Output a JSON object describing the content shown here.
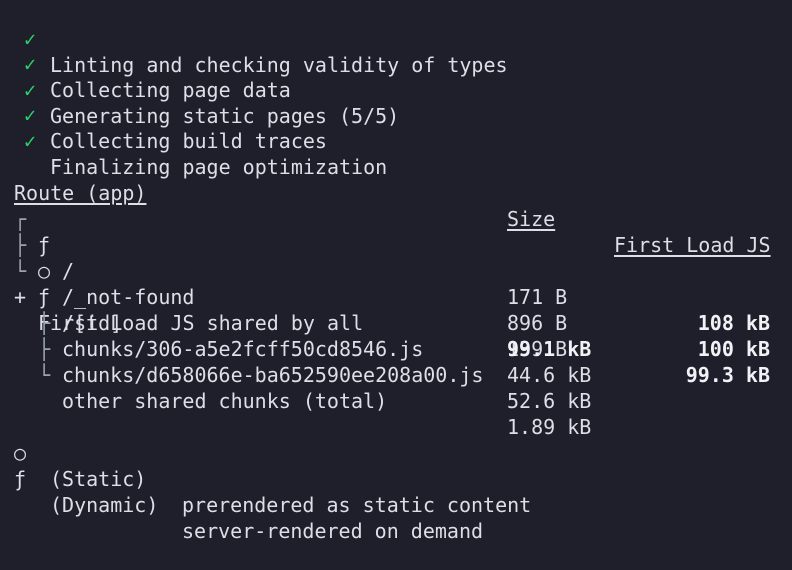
{
  "steps": [
    {
      "icon": "✓",
      "label": "Linting and checking validity of types"
    },
    {
      "icon": "✓",
      "label": "Collecting page data"
    },
    {
      "icon": "✓",
      "label": "Generating static pages (5/5)"
    },
    {
      "icon": "✓",
      "label": "Collecting build traces"
    },
    {
      "icon": "✓",
      "label": "Finalizing page optimization"
    }
  ],
  "table": {
    "headers": {
      "route": "Route (app)",
      "size": "Size",
      "first_load": "First Load JS"
    },
    "routes": [
      {
        "tree": "┌",
        "symbol": "ƒ",
        "path": "/",
        "size": "171 B",
        "first_load": "108 kB"
      },
      {
        "tree": "├",
        "symbol": "○",
        "path": "/_not-found",
        "size": "896 B",
        "first_load": "100 kB"
      },
      {
        "tree": "└",
        "symbol": "ƒ",
        "path": "/[id]",
        "size": "139 B",
        "first_load": "99.3 kB"
      }
    ],
    "shared": {
      "prefix": "+",
      "label": "First Load JS shared by all",
      "size": "99.1 kB",
      "chunks": [
        {
          "tree": "├",
          "name": "chunks/306-a5e2fcff50cd8546.js",
          "size": "44.6 kB"
        },
        {
          "tree": "├",
          "name": "chunks/d658066e-ba652590ee208a00.js",
          "size": "52.6 kB"
        },
        {
          "tree": "└",
          "name": "other shared chunks (total)",
          "size": "1.89 kB"
        }
      ]
    }
  },
  "legend": [
    {
      "symbol": "○",
      "name": "(Static)",
      "description": "prerendered as static content"
    },
    {
      "symbol": "ƒ",
      "name": "(Dynamic)",
      "description": "server-rendered on demand"
    }
  ],
  "colors": {
    "background": "#1e1f2b",
    "text": "#dcdfe6",
    "check": "#2bd36b"
  }
}
